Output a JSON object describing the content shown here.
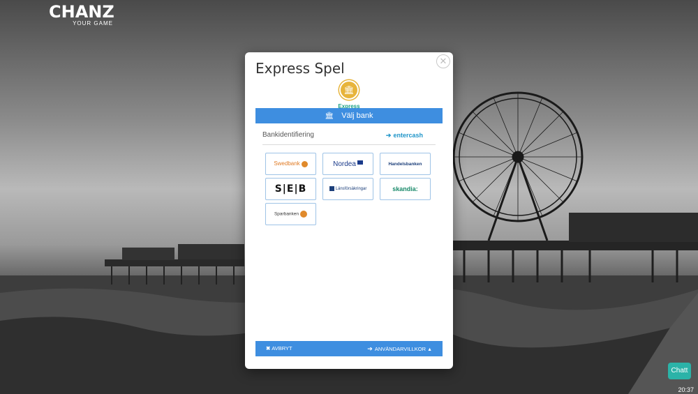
{
  "logo": {
    "brand": "CHANZ",
    "tagline": "YOUR GAME"
  },
  "modal": {
    "title": "Express Spel",
    "close_icon": "close-icon",
    "method": {
      "icon": "bank-icon",
      "label": "Express",
      "color": "#e7b43b"
    },
    "select_bank_label": "Välj bank",
    "bank_identification_label": "Bankidentifiering",
    "provider": "entercash",
    "banks": [
      {
        "id": "swedbank",
        "label": "Swedbank"
      },
      {
        "id": "nordea",
        "label": "Nordea"
      },
      {
        "id": "handelsbanken",
        "label": "Handelsbanken"
      },
      {
        "id": "seb",
        "label": "S|E|B"
      },
      {
        "id": "lansforsakringar",
        "label": "Länsförsäkringar"
      },
      {
        "id": "skandia",
        "label": "skandia:"
      },
      {
        "id": "sparbanken",
        "label": "Sparbanken"
      }
    ],
    "footer": {
      "cancel_label": "AVBRYT",
      "terms_label": "ANVÄNDARVILLKOR"
    }
  },
  "chat": {
    "label": "Chatt"
  },
  "clock": "20:37",
  "colors": {
    "accent": "#3e8ee0",
    "chat": "#2bb3a8",
    "express": "#e7b43b"
  }
}
